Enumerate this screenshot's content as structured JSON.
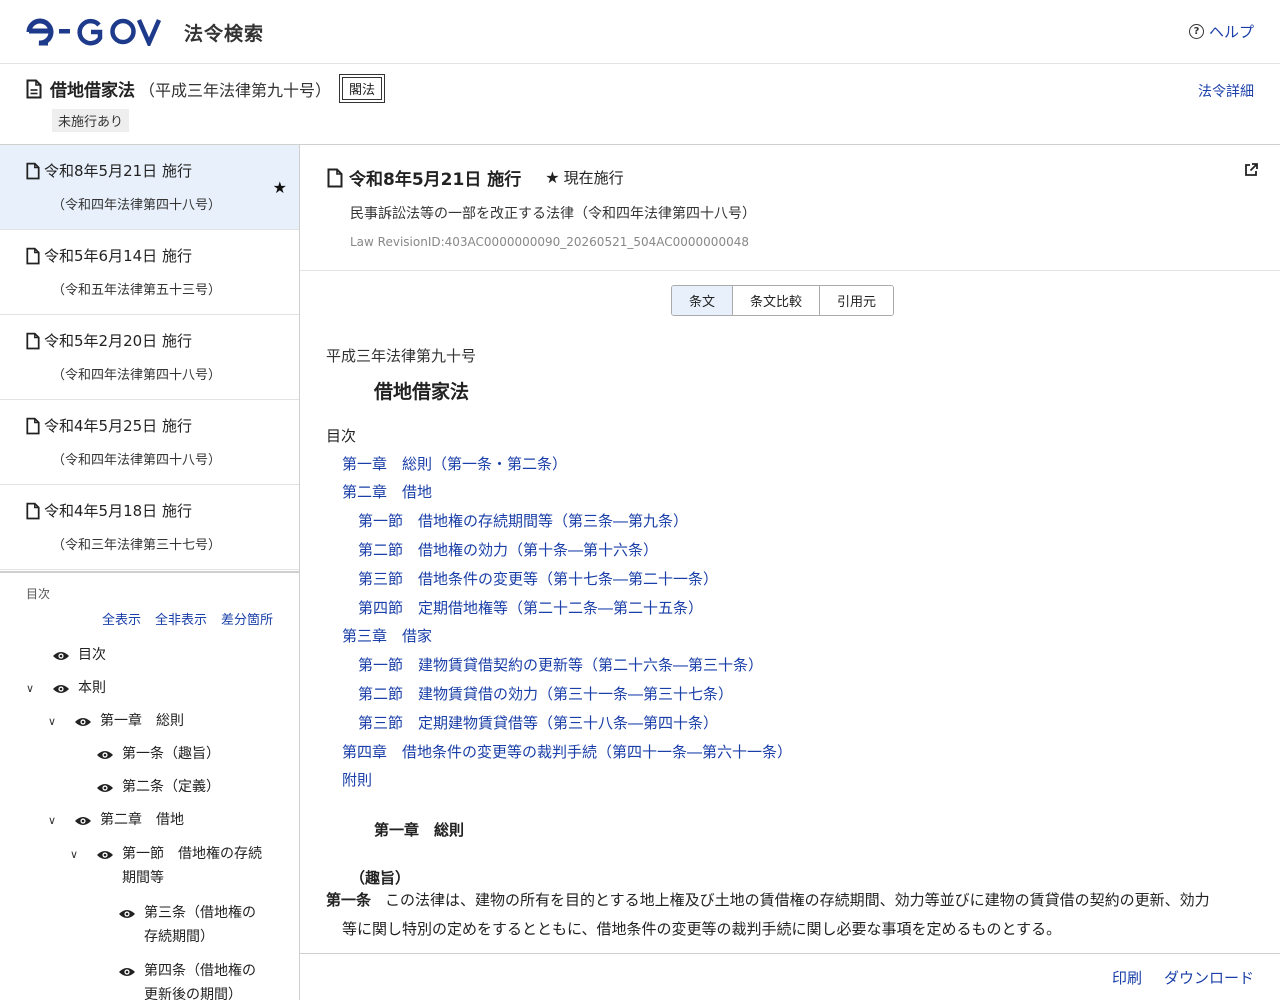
{
  "header": {
    "logo_text": "e-GOV",
    "site_name": "法令検索",
    "help_label": "ヘルプ"
  },
  "law": {
    "title": "借地借家法",
    "number": "（平成三年法律第九十号）",
    "short_title": "閣法",
    "badge": "未施行あり",
    "detail_link": "法令詳細"
  },
  "revisions": [
    {
      "date": "令和8年5月21日 施行",
      "law": "（令和四年法律第四十八号）"
    },
    {
      "date": "令和5年6月14日 施行",
      "law": "（令和五年法律第五十三号）"
    },
    {
      "date": "令和5年2月20日 施行",
      "law": "（令和四年法律第四十八号）"
    },
    {
      "date": "令和4年5月25日 施行",
      "law": "（令和四年法律第四十八号）"
    },
    {
      "date": "令和4年5月18日 施行",
      "law": "（令和三年法律第三十七号）"
    }
  ],
  "sidebar_toc": {
    "heading": "目次",
    "show_all": "全表示",
    "hide_all": "全非表示",
    "diff": "差分箇所",
    "nodes": [
      {
        "label": "目次"
      },
      {
        "label": "本則"
      },
      {
        "label": "第一章　総則"
      },
      {
        "label": "第一条（趣旨）"
      },
      {
        "label": "第二条（定義）"
      },
      {
        "label": "第二章　借地"
      },
      {
        "label": "第一節　借地権の存続期間等"
      },
      {
        "label": "第三条（借地権の存続期間）"
      },
      {
        "label": "第四条（借地権の更新後の期間）"
      }
    ]
  },
  "main": {
    "rev_title": "令和8年5月21日 施行",
    "current_label": "現在施行",
    "amend_law": "民事訴訟法等の一部を改正する法律（令和四年法律第四十八号）",
    "revision_id": "Law RevisionID:403AC0000000090_20260521_504AC0000000048",
    "tabs": [
      "条文",
      "条文比較",
      "引用元"
    ],
    "body": {
      "law_number": "平成三年法律第九十号",
      "law_title": "借地借家法",
      "toc_label": "目次",
      "toc": [
        "第一章　総則（第一条・第二条）",
        "第二章　借地",
        "第一節　借地権の存続期間等（第三条―第九条）",
        "第二節　借地権の効力（第十条―第十六条）",
        "第三節　借地条件の変更等（第十七条―第二十一条）",
        "第四節　定期借地権等（第二十二条―第二十五条）",
        "第三章　借家",
        "第一節　建物賃貸借契約の更新等（第二十六条―第三十条）",
        "第二節　建物賃貸借の効力（第三十一条―第三十七条）",
        "第三節　定期建物賃貸借等（第三十八条―第四十条）",
        "第四章　借地条件の変更等の裁判手続（第四十一条―第六十一条）",
        "附則"
      ],
      "chapter1": "第一章　総則",
      "caption1": "（趣旨）",
      "article1_label": "第一条",
      "article1_text": "この法律は、建物の所有を目的とする地上権及び土地の賃借権の存続期間、効力等並びに建物の賃貸借の契約の更新、効力等に関し特別の定めをするとともに、借地条件の変更等の裁判手続に関し必要な事項を定めるものとする。"
    }
  },
  "footer": {
    "print": "印刷",
    "download": "ダウンロード"
  },
  "colors": {
    "link": "#1a3fa8",
    "active_bg": "#e8f1fb",
    "logo": "#1e3a8a"
  }
}
